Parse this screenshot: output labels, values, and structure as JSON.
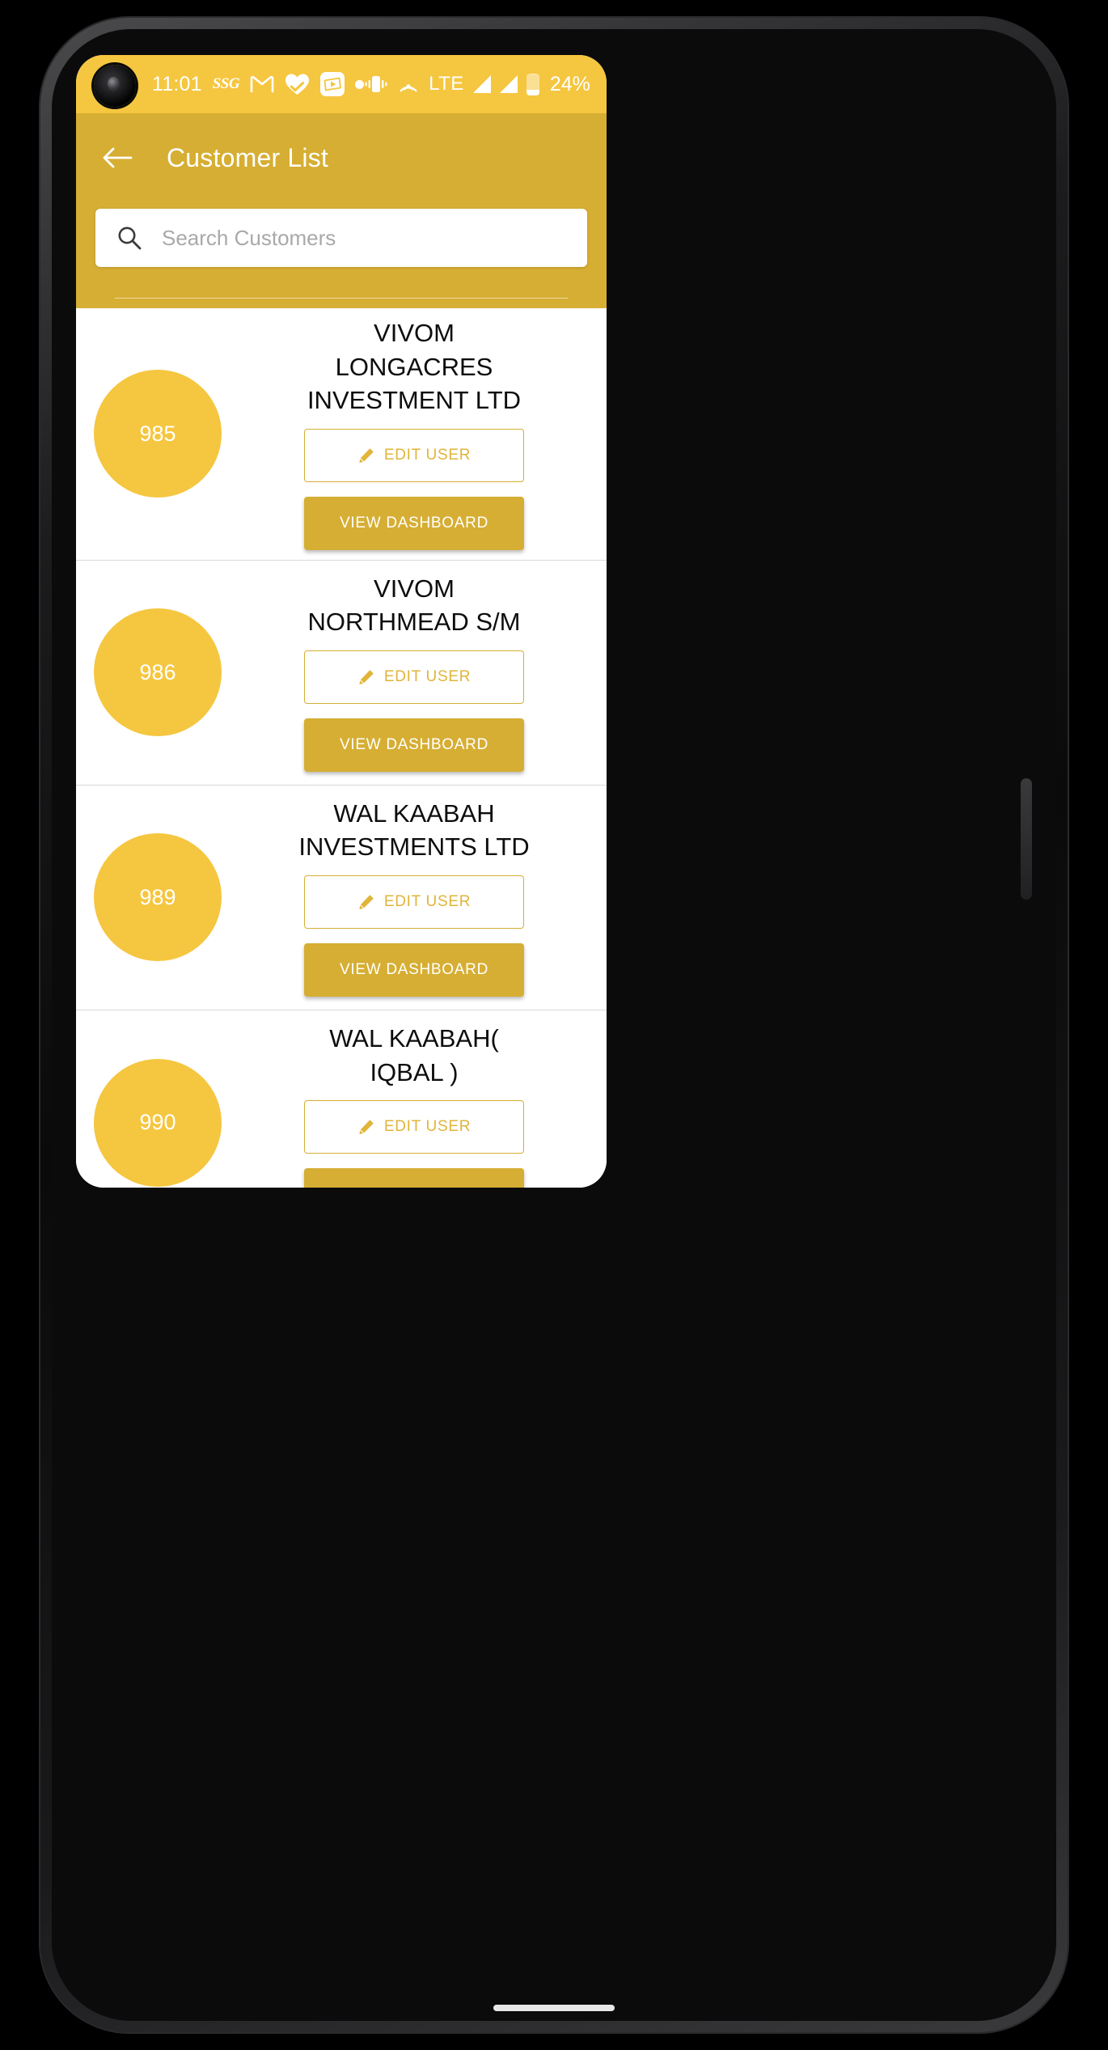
{
  "status_bar": {
    "time": "11:01",
    "ssg_label": "SSG",
    "lte_label": "LTE",
    "battery_percent": "24%",
    "battery_level": 24,
    "left_icons": [
      "ssg-icon",
      "gmail-icon",
      "health-heart-icon",
      "media-player-icon",
      "dot-icon"
    ],
    "right_icons": [
      "vibrate-icon",
      "hotspot-icon",
      "lte-label",
      "signal-icon-1",
      "signal-icon-2",
      "battery-icon"
    ],
    "background_color": "#F5C63F"
  },
  "app_bar": {
    "title": "Customer List",
    "back_icon": "arrow-left-icon",
    "background_color": "#D6AE33"
  },
  "search": {
    "placeholder": "Search Customers",
    "value": "",
    "icon": "search-icon"
  },
  "buttons": {
    "edit_label": "EDIT USER",
    "edit_icon": "pencil-icon",
    "dashboard_label": "VIEW DASHBOARD"
  },
  "colors": {
    "status_yellow": "#F5C63F",
    "app_bar_gold": "#D6AE33",
    "avatar_yellow": "#F5C63F",
    "accent_gold": "#D6AE33",
    "edit_text": "#E0B53A"
  },
  "customers": [
    {
      "id": "985",
      "name": "VIVOM LONGACRES INVESTMENT LTD"
    },
    {
      "id": "986",
      "name": "VIVOM NORTHMEAD S/M"
    },
    {
      "id": "989",
      "name": "WAL KAABAH INVESTMENTS LTD"
    },
    {
      "id": "990",
      "name": "WAL KAABAH( IQBAL )"
    }
  ]
}
